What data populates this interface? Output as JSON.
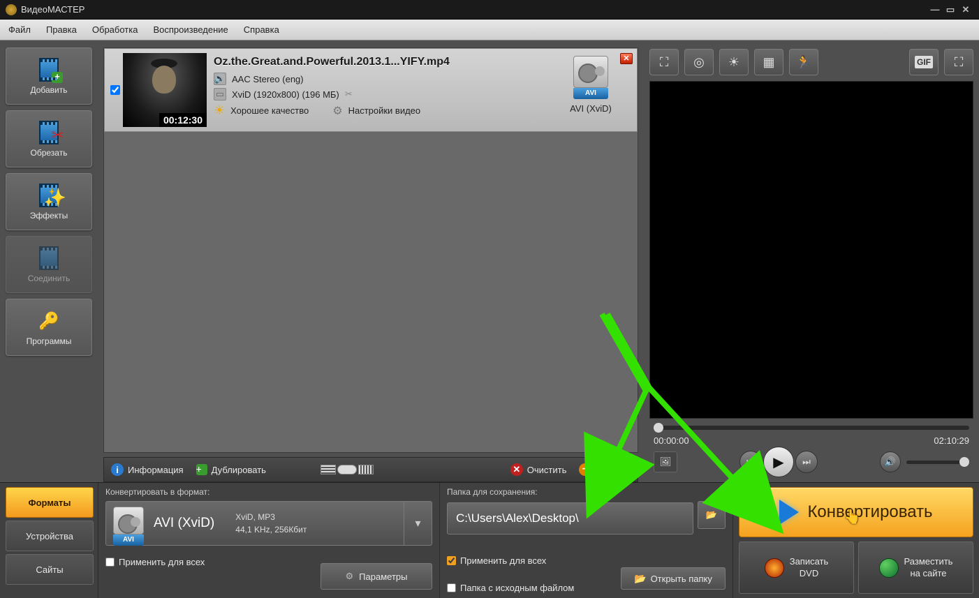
{
  "window": {
    "title": "ВидеоМАСТЕР"
  },
  "menu": {
    "file": "Файл",
    "edit": "Правка",
    "processing": "Обработка",
    "playback": "Воспроизведение",
    "help": "Справка"
  },
  "sidebar": {
    "add": "Добавить",
    "trim": "Обрезать",
    "effects": "Эффекты",
    "join": "Соединить",
    "programs": "Программы"
  },
  "file": {
    "name": "Oz.the.Great.and.Powerful.2013.1...YIFY.mp4",
    "duration": "00:12:30",
    "audio": "AAC Stereo (eng)",
    "video": "XviD (1920x800) (196 МБ)",
    "quality": "Хорошее качество",
    "settings": "Настройки видео",
    "out_format": "AVI (XviD)",
    "out_tag": "AVI"
  },
  "listbar": {
    "info": "Информация",
    "duplicate": "Дублировать",
    "clear": "Очистить",
    "delete": "Удалить"
  },
  "player": {
    "current": "00:00:00",
    "total": "02:10:29"
  },
  "tabs": {
    "formats": "Форматы",
    "devices": "Устройства",
    "sites": "Сайты"
  },
  "format_panel": {
    "header": "Конвертировать в формат:",
    "name": "AVI (XviD)",
    "tag": "AVI",
    "line1": "XviD, MP3",
    "line2": "44,1 KHz, 256Кбит",
    "apply_all": "Применить для всех",
    "params": "Параметры"
  },
  "save_panel": {
    "header": "Папка для сохранения:",
    "path": "C:\\Users\\Alex\\Desktop\\",
    "apply_all": "Применить для всех",
    "same_folder": "Папка с исходным файлом",
    "open": "Открыть папку"
  },
  "actions": {
    "convert": "Конвертировать",
    "burn1": "Записать",
    "burn2": "DVD",
    "publish1": "Разместить",
    "publish2": "на сайте"
  }
}
